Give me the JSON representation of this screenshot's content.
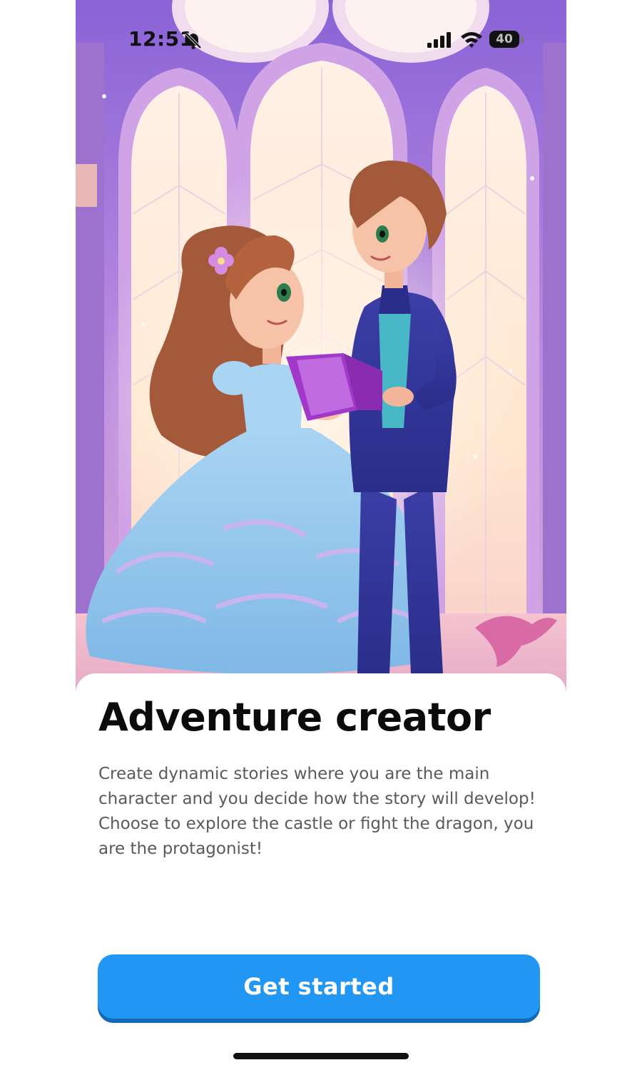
{
  "status_bar": {
    "time": "12:51",
    "battery_level": "40",
    "icons": [
      "bell-slash-icon",
      "cellular-signal-icon",
      "wifi-icon",
      "battery-icon"
    ]
  },
  "hero": {
    "illustration": "princess-and-prince-reading-book-in-castle"
  },
  "content": {
    "title": "Adventure creator",
    "description": "Create dynamic stories where you are the main character and you decide how the story will develop! Choose to explore the castle or fight the dragon, you are the protagonist!",
    "button_label": "Get started"
  },
  "colors": {
    "accent": "#2196f3",
    "accent_shadow": "#1567b8",
    "title": "#0b0b0b",
    "body_text": "#5a5a5a",
    "background": "#ffffff"
  }
}
